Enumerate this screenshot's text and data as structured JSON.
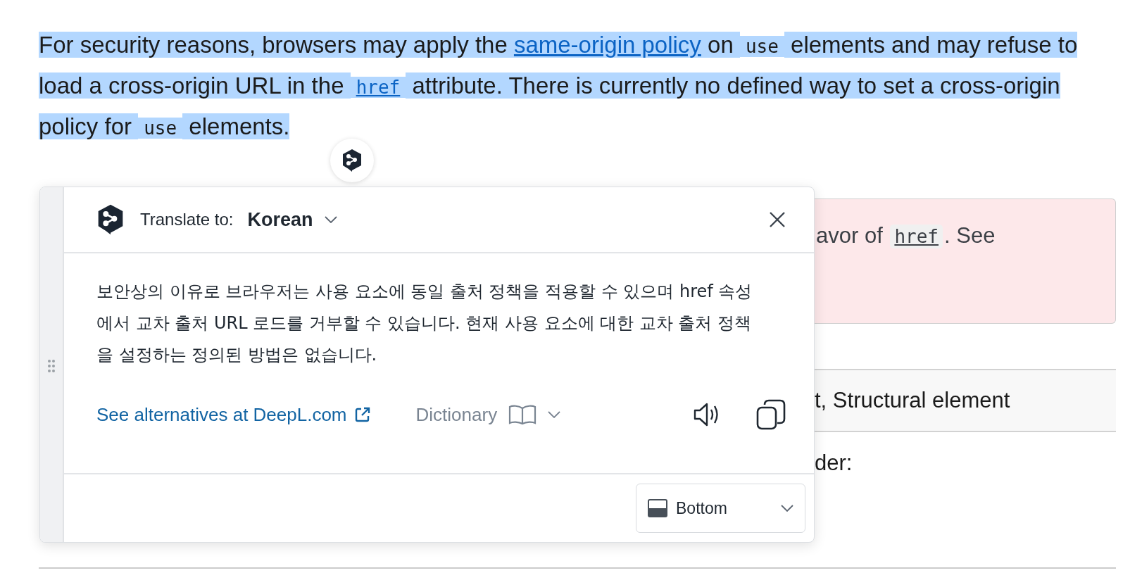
{
  "paragraph": {
    "selected": true,
    "segments": [
      {
        "kind": "text",
        "text": "For security reasons, browsers may apply the "
      },
      {
        "kind": "link",
        "text": "same-origin policy"
      },
      {
        "kind": "text",
        "text": " on "
      },
      {
        "kind": "code",
        "text": "use"
      },
      {
        "kind": "text",
        "text": " elements and may refuse to load a cross-origin URL in the "
      },
      {
        "kind": "code_link",
        "text": "href"
      },
      {
        "kind": "text",
        "text": " attribute. There is currently no defined way to set a cross-origin policy for "
      },
      {
        "kind": "code",
        "text": "use"
      },
      {
        "kind": "text",
        "text": " elements."
      }
    ]
  },
  "note": {
    "segments": [
      {
        "kind": "text",
        "text": "avor of "
      },
      {
        "kind": "code",
        "text": "href"
      },
      {
        "kind": "text",
        "text": ". See"
      }
    ]
  },
  "table_row": {
    "cell": "t, Structural element"
  },
  "after_table": "der:",
  "popup": {
    "translate_label": "Translate to:",
    "language": "Korean",
    "translation": "보안상의 이유로 브라우저는 사용 요소에 동일 출처 정책을 적용할 수 있으며 href 속성에서 교차 출처 URL 로드를 거부할 수 있습니다. 현재 사용 요소에 대한 교차 출처 정책을 설정하는 정의된 방법은 없습니다.",
    "alternatives_link": "See alternatives at DeepL.com",
    "dictionary_label": "Dictionary",
    "position_select": "Bottom"
  }
}
